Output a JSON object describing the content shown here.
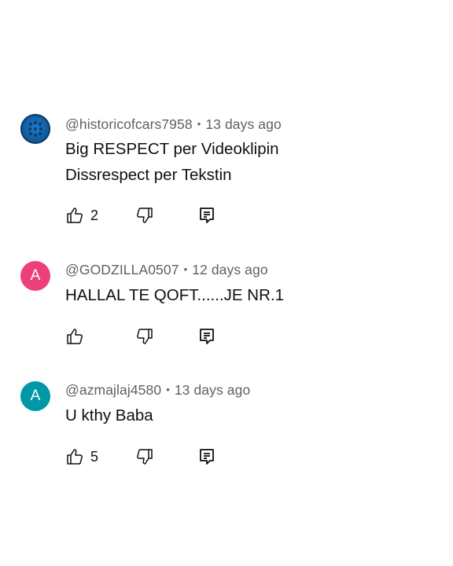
{
  "comments": [
    {
      "handle": "@historicofcars7958",
      "separator": "•",
      "time": "13 days ago",
      "lines": [
        "Big RESPECT per Videoklipin",
        "Dissrespect per Tekstin"
      ],
      "likes": "2",
      "avatar_letter": "",
      "avatar_color": "#1565a8"
    },
    {
      "handle": "@GODZILLA0507",
      "separator": "•",
      "time": "12 days ago",
      "lines": [
        "HALLAL TE QOFT......JE NR.1"
      ],
      "likes": "",
      "avatar_letter": "A",
      "avatar_color": "#ec407a"
    },
    {
      "handle": "@azmajlaj4580",
      "separator": "•",
      "time": "13 days ago",
      "lines": [
        "U kthy Baba"
      ],
      "likes": "5",
      "avatar_letter": "A",
      "avatar_color": "#0097a7"
    }
  ],
  "icons": {
    "like": "thumbs-up-icon",
    "dislike": "thumbs-down-icon",
    "reply": "reply-comment-icon"
  }
}
